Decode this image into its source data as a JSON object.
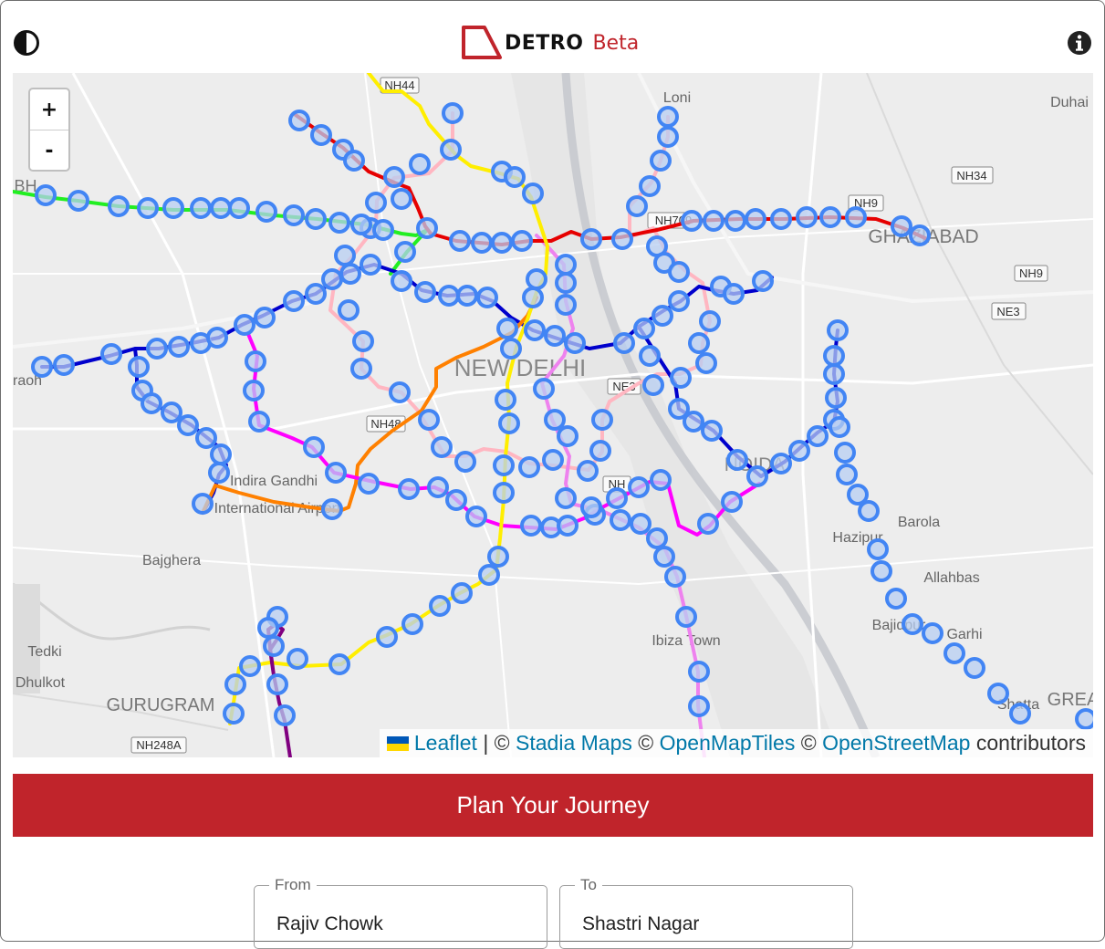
{
  "app": {
    "name": "DETRO",
    "badge": "Beta"
  },
  "header": {
    "theme_icon": "contrast-icon",
    "info_icon": "info-icon"
  },
  "map": {
    "zoom_in": "+",
    "zoom_out": "-",
    "labels": {
      "nh44": "NH44",
      "loni": "Loni",
      "duhai": "Duhai",
      "nh34": "NH34",
      "nh9a": "NH9",
      "nh709": "NH709",
      "ghaziabad": "GHAZIABAD",
      "nh9b": "NH9",
      "ne3": "NE3",
      "new_delhi": "NEW DELHI",
      "ne3b": "NE3",
      "nh48": "NH48",
      "igi1": "Indira Gandhi",
      "igi2": "International Airport",
      "noida": "NOIDA",
      "nh_mid": "NH",
      "barola": "Barola",
      "hazipur": "Hazipur",
      "allahbas": "Allahbas",
      "bajidpur": "Bajidpur",
      "garhi": "Garhi",
      "bajghera": "Bajghera",
      "tedki": "Tedki",
      "dhulkot": "Dhulkot",
      "gurugram": "GURUGRAM",
      "nh248a": "NH248A",
      "ibiza": "Ibiza Town",
      "shatta": "Shatta",
      "grea": "GREA",
      "bh": "BH",
      "raoh": "raoh"
    },
    "attribution": {
      "leaflet": "Leaflet",
      "sep": "| ©",
      "stadia": "Stadia Maps",
      "c1": "©",
      "omt": "OpenMapTiles",
      "c2": "©",
      "osm": "OpenStreetMap",
      "contrib": "contributors"
    },
    "line_colors": {
      "red": "#e60000",
      "green": "#22ee22",
      "blue": "#0000cc",
      "yellow": "#ffee00",
      "orange": "#ff8000",
      "magenta": "#ff00ff",
      "pink": "#ffb6c1",
      "violet": "#ee82ee",
      "purple": "#800080",
      "station_ring": "#4285f4"
    }
  },
  "plan": {
    "title": "Plan Your Journey"
  },
  "form": {
    "from": {
      "label": "From",
      "value": "Rajiv Chowk"
    },
    "to": {
      "label": "To",
      "value": "Shastri Nagar"
    }
  }
}
